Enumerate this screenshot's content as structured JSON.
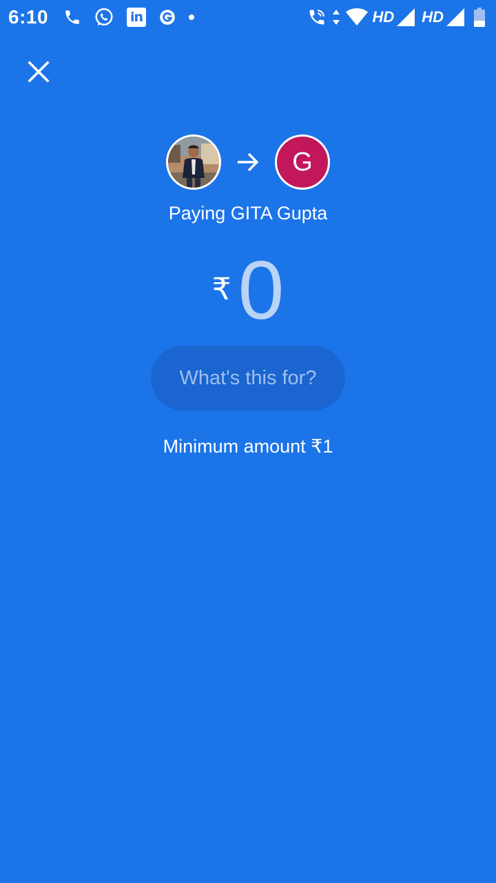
{
  "status_bar": {
    "time": "6:10",
    "left_icons": [
      "phone-icon",
      "whatsapp-icon",
      "linkedin-icon",
      "g-app-icon",
      "dot-icon"
    ],
    "right_icons": [
      "wifi-calling-icon",
      "data-arrows-icon",
      "wifi-icon",
      "signal-icon",
      "battery-icon"
    ],
    "hd_label_1": "HD",
    "hd_label_2": "HD",
    "linkedin_text": "in"
  },
  "header": {
    "close_icon": "close-icon"
  },
  "payment": {
    "recipient_initial": "G",
    "paying_label": "Paying GITA Gupta",
    "currency": "₹",
    "amount": "0",
    "note_placeholder": "What's this for?",
    "minimum_amount": "Minimum amount ₹1"
  },
  "colors": {
    "background": "#1c74e9",
    "recipient_avatar": "#c2185b",
    "note_field": "#1a65cf",
    "amount_text": "#b9d4f7"
  }
}
